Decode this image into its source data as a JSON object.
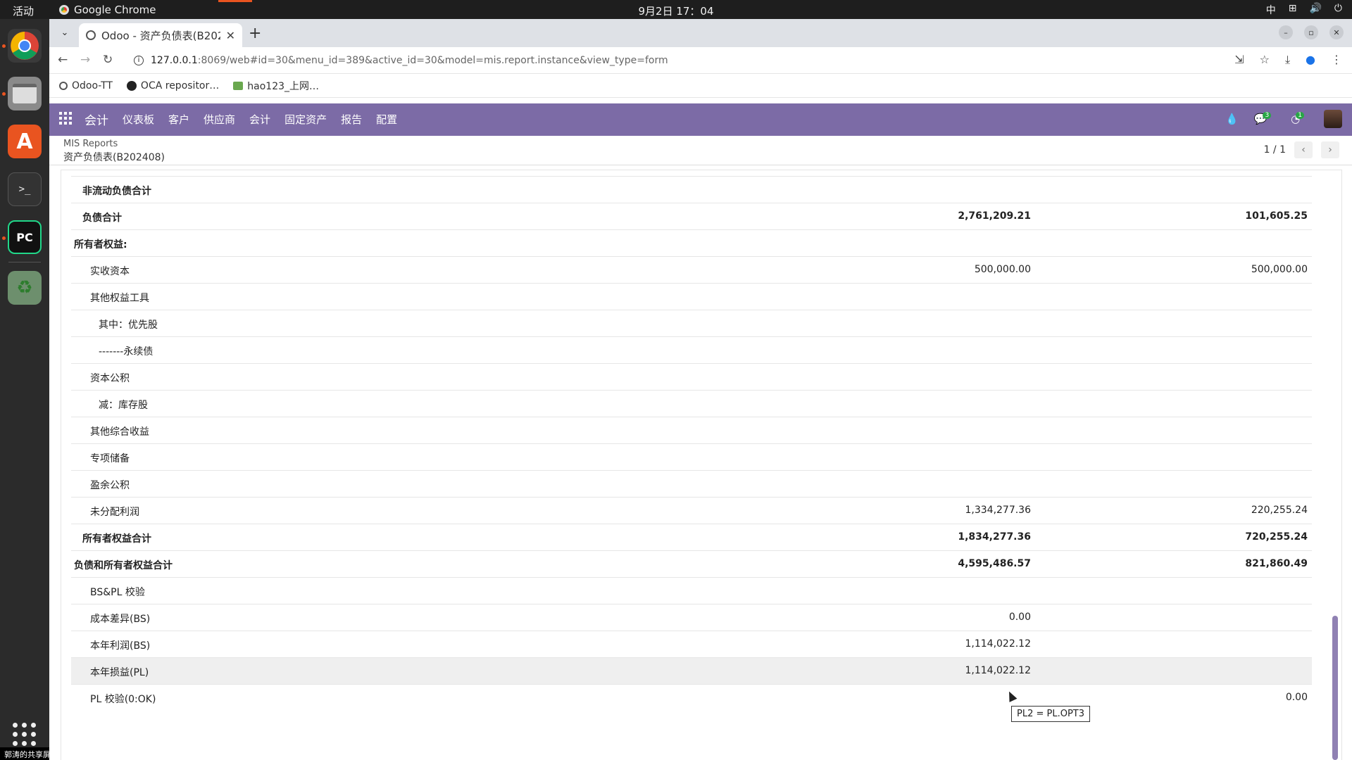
{
  "system": {
    "activities": "活动",
    "app_name": "Google Chrome",
    "clock": "9月2日 17：04",
    "input_method": "中",
    "share_label": "郭涛的共享屏幕"
  },
  "browser": {
    "tab_title": "Odoo - 资产负债表(B202",
    "url_host": "127.0.0.1",
    "url_rest": ":8069/web#id=30&menu_id=389&active_id=30&model=mis.report.instance&view_type=form",
    "bookmarks": [
      "Odoo-TT",
      "OCA repositor…",
      "hao123_上网…"
    ]
  },
  "odoo": {
    "app": "会计",
    "menu": [
      "仪表板",
      "客户",
      "供应商",
      "会计",
      "固定资产",
      "报告",
      "配置"
    ],
    "messages_badge": "3",
    "activities_badge": "1",
    "breadcrumb_parent": "MIS Reports",
    "breadcrumb_current": "资产负债表(B202408)",
    "pager": "1 / 1"
  },
  "report_rows": [
    {
      "label": "非流动负债合计",
      "indent": 1,
      "bold": true,
      "v1": "",
      "v2": ""
    },
    {
      "label": "负债合计",
      "indent": 1,
      "bold": true,
      "v1": "2,761,209.21",
      "v2": "101,605.25"
    },
    {
      "label": "所有者权益:",
      "indent": 0,
      "bold": true,
      "v1": "",
      "v2": ""
    },
    {
      "label": "实收资本",
      "indent": 2,
      "bold": false,
      "v1": "500,000.00",
      "v2": "500,000.00"
    },
    {
      "label": "其他权益工具",
      "indent": 2,
      "bold": false,
      "v1": "",
      "v2": ""
    },
    {
      "label": "其中：优先股",
      "indent": 3,
      "bold": false,
      "v1": "",
      "v2": ""
    },
    {
      "label": "-------永续债",
      "indent": 3,
      "bold": false,
      "v1": "",
      "v2": ""
    },
    {
      "label": "资本公积",
      "indent": 2,
      "bold": false,
      "v1": "",
      "v2": ""
    },
    {
      "label": "减：库存股",
      "indent": 3,
      "bold": false,
      "v1": "",
      "v2": ""
    },
    {
      "label": "其他综合收益",
      "indent": 2,
      "bold": false,
      "v1": "",
      "v2": ""
    },
    {
      "label": "专项储备",
      "indent": 2,
      "bold": false,
      "v1": "",
      "v2": ""
    },
    {
      "label": "盈余公积",
      "indent": 2,
      "bold": false,
      "v1": "",
      "v2": ""
    },
    {
      "label": "未分配利润",
      "indent": 2,
      "bold": false,
      "v1": "1,334,277.36",
      "v2": "220,255.24"
    },
    {
      "label": "所有者权益合计",
      "indent": 1,
      "bold": true,
      "v1": "1,834,277.36",
      "v2": "720,255.24"
    },
    {
      "label": "负债和所有者权益合计",
      "indent": 0,
      "bold": true,
      "v1": "4,595,486.57",
      "v2": "821,860.49"
    },
    {
      "label": "BS&PL 校验",
      "indent": 2,
      "bold": false,
      "v1": "",
      "v2": ""
    },
    {
      "label": "成本差异(BS)",
      "indent": 2,
      "bold": false,
      "v1": "0.00",
      "v2": ""
    },
    {
      "label": "本年利润(BS)",
      "indent": 2,
      "bold": false,
      "v1": "1,114,022.12",
      "v2": ""
    },
    {
      "label": "本年损益(PL)",
      "indent": 2,
      "bold": false,
      "v1": "1,114,022.12",
      "v2": "",
      "hover": true
    },
    {
      "label": "PL 校验(0:OK)",
      "indent": 2,
      "bold": false,
      "v1": "",
      "v2": "0.00"
    }
  ],
  "tooltip": "PL2 = PL.OPT3"
}
